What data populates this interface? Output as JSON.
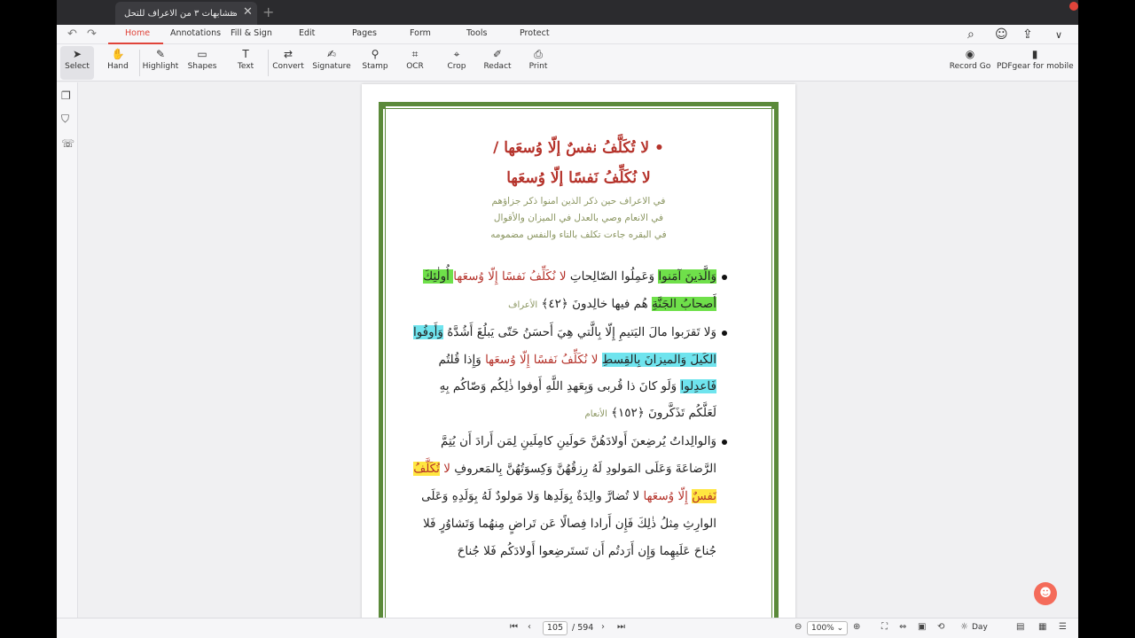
{
  "tabbar": {
    "tab_title": "متشابهات ٣ من الاعراف للتحل",
    "tab_chevron": "⌄",
    "close": "✕",
    "new_tab": "+"
  },
  "menubar": {
    "undo": "↶",
    "redo": "↷",
    "items": [
      {
        "label": "Home"
      },
      {
        "label": "Annotations"
      },
      {
        "label": "Fill & Sign"
      },
      {
        "label": "Edit"
      },
      {
        "label": "Pages"
      },
      {
        "label": "Form"
      },
      {
        "label": "Tools"
      },
      {
        "label": "Protect"
      }
    ],
    "right_icons": [
      "search-icon",
      "ai-assistant-icon",
      "share-icon",
      "chevron-down-icon"
    ]
  },
  "toolbar": {
    "tools": [
      {
        "label": "Select",
        "icon": "cursor-icon",
        "glyph": "➤"
      },
      {
        "label": "Hand",
        "icon": "hand-icon",
        "glyph": "✋"
      },
      {
        "label": "Highlight",
        "icon": "highlighter-icon",
        "glyph": "✎"
      },
      {
        "label": "Shapes",
        "icon": "shapes-icon",
        "glyph": "▭"
      },
      {
        "label": "Text",
        "icon": "text-icon",
        "glyph": "T"
      },
      {
        "label": "Convert",
        "icon": "convert-icon",
        "glyph": "⇄"
      },
      {
        "label": "Signature",
        "icon": "signature-icon",
        "glyph": "✍"
      },
      {
        "label": "Stamp",
        "icon": "stamp-icon",
        "glyph": "⚲"
      },
      {
        "label": "OCR",
        "icon": "ocr-icon",
        "glyph": "⌗"
      },
      {
        "label": "Crop",
        "icon": "crop-icon",
        "glyph": "⌖"
      },
      {
        "label": "Redact",
        "icon": "redact-icon",
        "glyph": "✐"
      },
      {
        "label": "Print",
        "icon": "print-icon",
        "glyph": "⎙"
      }
    ],
    "record_label": "Record Go",
    "mobile_label": "PDFgear for mobile"
  },
  "sidebar": {
    "icons": [
      "pages-icon",
      "bookmark-icon",
      "comments-icon"
    ]
  },
  "document": {
    "heading_line1": "• لا تُكَلَّفُ نفسٌ إلّا وُسعَها /",
    "heading_line2": "لا نُكَلِّفُ نَفسًا إلّا وُسعَها",
    "notes": [
      "في الاعراف حين ذكر الذين  امنوا ذكر جزاؤهم",
      "في الانعام وصي بالعدل في الميزان والأقوال",
      "في البقره جاءت تكلف بالتاء والنفس مضمومه"
    ],
    "v1_l1_a": "وَالَّذينَ آمَنوا",
    "v1_l1_b": " وَعَمِلُوا الصّالِحاتِ ",
    "v1_l1_c": "لا نُكَلِّفُ نَفسًا إِلّا وُسعَها",
    "v1_l1_d": " أُولٰئِكَ",
    "v1_l2_a": "أَصحابُ الجَنَّةِ",
    "v1_l2_b": " هُم فيها خالِدونَ ﴿٤٢﴾ ",
    "v1_l2_ref": "الأعراف",
    "v2_l1_a": "وَلا تَقرَبوا مالَ اليَتيمِ إِلّا بِالَّتي هِيَ أَحسَنُ حَتّى يَبلُغَ أَشُدَّهُ ",
    "v2_l1_b": "وَأَوفُوا",
    "v2_l2_a": "الكَيلَ وَالميزانَ بِالقِسطِ",
    "v2_l2_b": " لا نُكَلِّفُ نَفسًا إِلّا وُسعَها",
    "v2_l2_c": " وَإِذا قُلتُم",
    "v2_l3_a": "فَاعدِلوا",
    "v2_l3_b": " وَلَو كانَ ذا قُربى وَبِعَهدِ اللَّهِ أَوفوا ذٰلِكُم وَصّاكُم بِهِ",
    "v2_l4_a": "لَعَلَّكُم تَذَكَّرونَ ﴿١٥٢﴾ ",
    "v2_l4_ref": "الأنعام",
    "v3_l1": "وَالوالِداتُ يُرضِعنَ أَولادَهُنَّ حَولَينِ كامِلَينِ لِمَن أَرادَ أَن يُتِمَّ",
    "v3_l2_a": "الرَّضاعَةَ وَعَلَى المَولودِ لَهُ رِزقُهُنَّ وَكِسوَتُهُنَّ بِالمَعروفِ ",
    "v3_l2_b": "لا ",
    "v3_l2_c": "تُكَلَّفُ",
    "v3_l3_a": "نَفسٌ",
    "v3_l3_b": " إِلّا وُسعَها",
    "v3_l3_c": " لا تُضارَّ والِدَةٌ بِوَلَدِها وَلا مَولودٌ لَهُ بِوَلَدِهِ وَعَلَى",
    "v3_l4": "الوارِثِ مِثلُ ذٰلِكَ فَإِن أَرادا فِصالًا عَن تَراضٍ مِنهُما وَتَشاوُرٍ فَلا",
    "v3_l5": "جُناحَ عَلَيهِما وَإِن أَرَدتُم أَن تَستَرضِعوا أَولادَكُم فَلا جُناحَ"
  },
  "statusbar": {
    "current_page": "105",
    "total_pages": "/ 594",
    "zoom": "100%",
    "view_mode": "Day"
  },
  "colors": {
    "accent": "#e0443a",
    "frame": "#5b8a3a",
    "verse_red": "#b5332b",
    "highlight_green": "#6fe04a",
    "highlight_cyan": "#6fe4ee",
    "highlight_yellow": "#ffe640"
  }
}
